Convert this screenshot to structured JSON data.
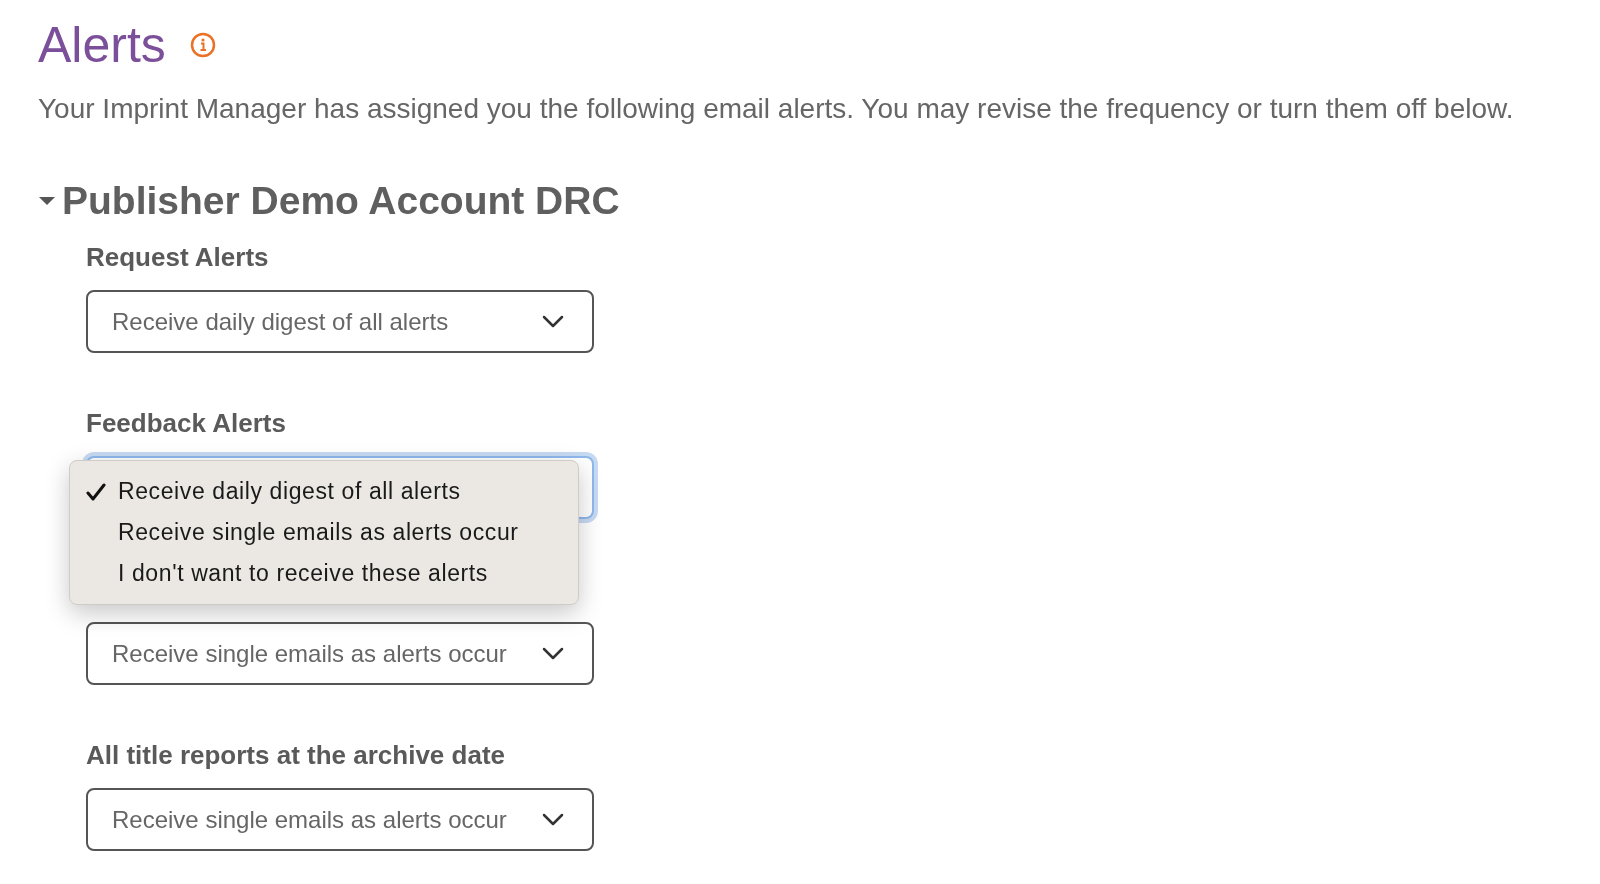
{
  "page": {
    "title": "Alerts",
    "description": "Your Imprint Manager has assigned you the following email alerts. You may revise the frequency or turn them off below."
  },
  "group": {
    "name": "Publisher Demo Account DRC",
    "expanded": true,
    "sections": [
      {
        "label": "Request Alerts",
        "value": "Receive daily digest of all alerts",
        "focused": false
      },
      {
        "label": "Feedback Alerts",
        "focused": true,
        "menu": {
          "options": [
            {
              "label": "Receive daily digest of all alerts",
              "selected": true
            },
            {
              "label": "Receive single emails as alerts occur",
              "selected": false
            },
            {
              "label": "I don't want to receive these alerts",
              "selected": false
            }
          ]
        }
      },
      {
        "value": "Receive single emails as alerts occur",
        "focused": false
      },
      {
        "label": "All title reports at the archive date",
        "value": "Receive single emails as alerts occur",
        "focused": false
      }
    ]
  }
}
